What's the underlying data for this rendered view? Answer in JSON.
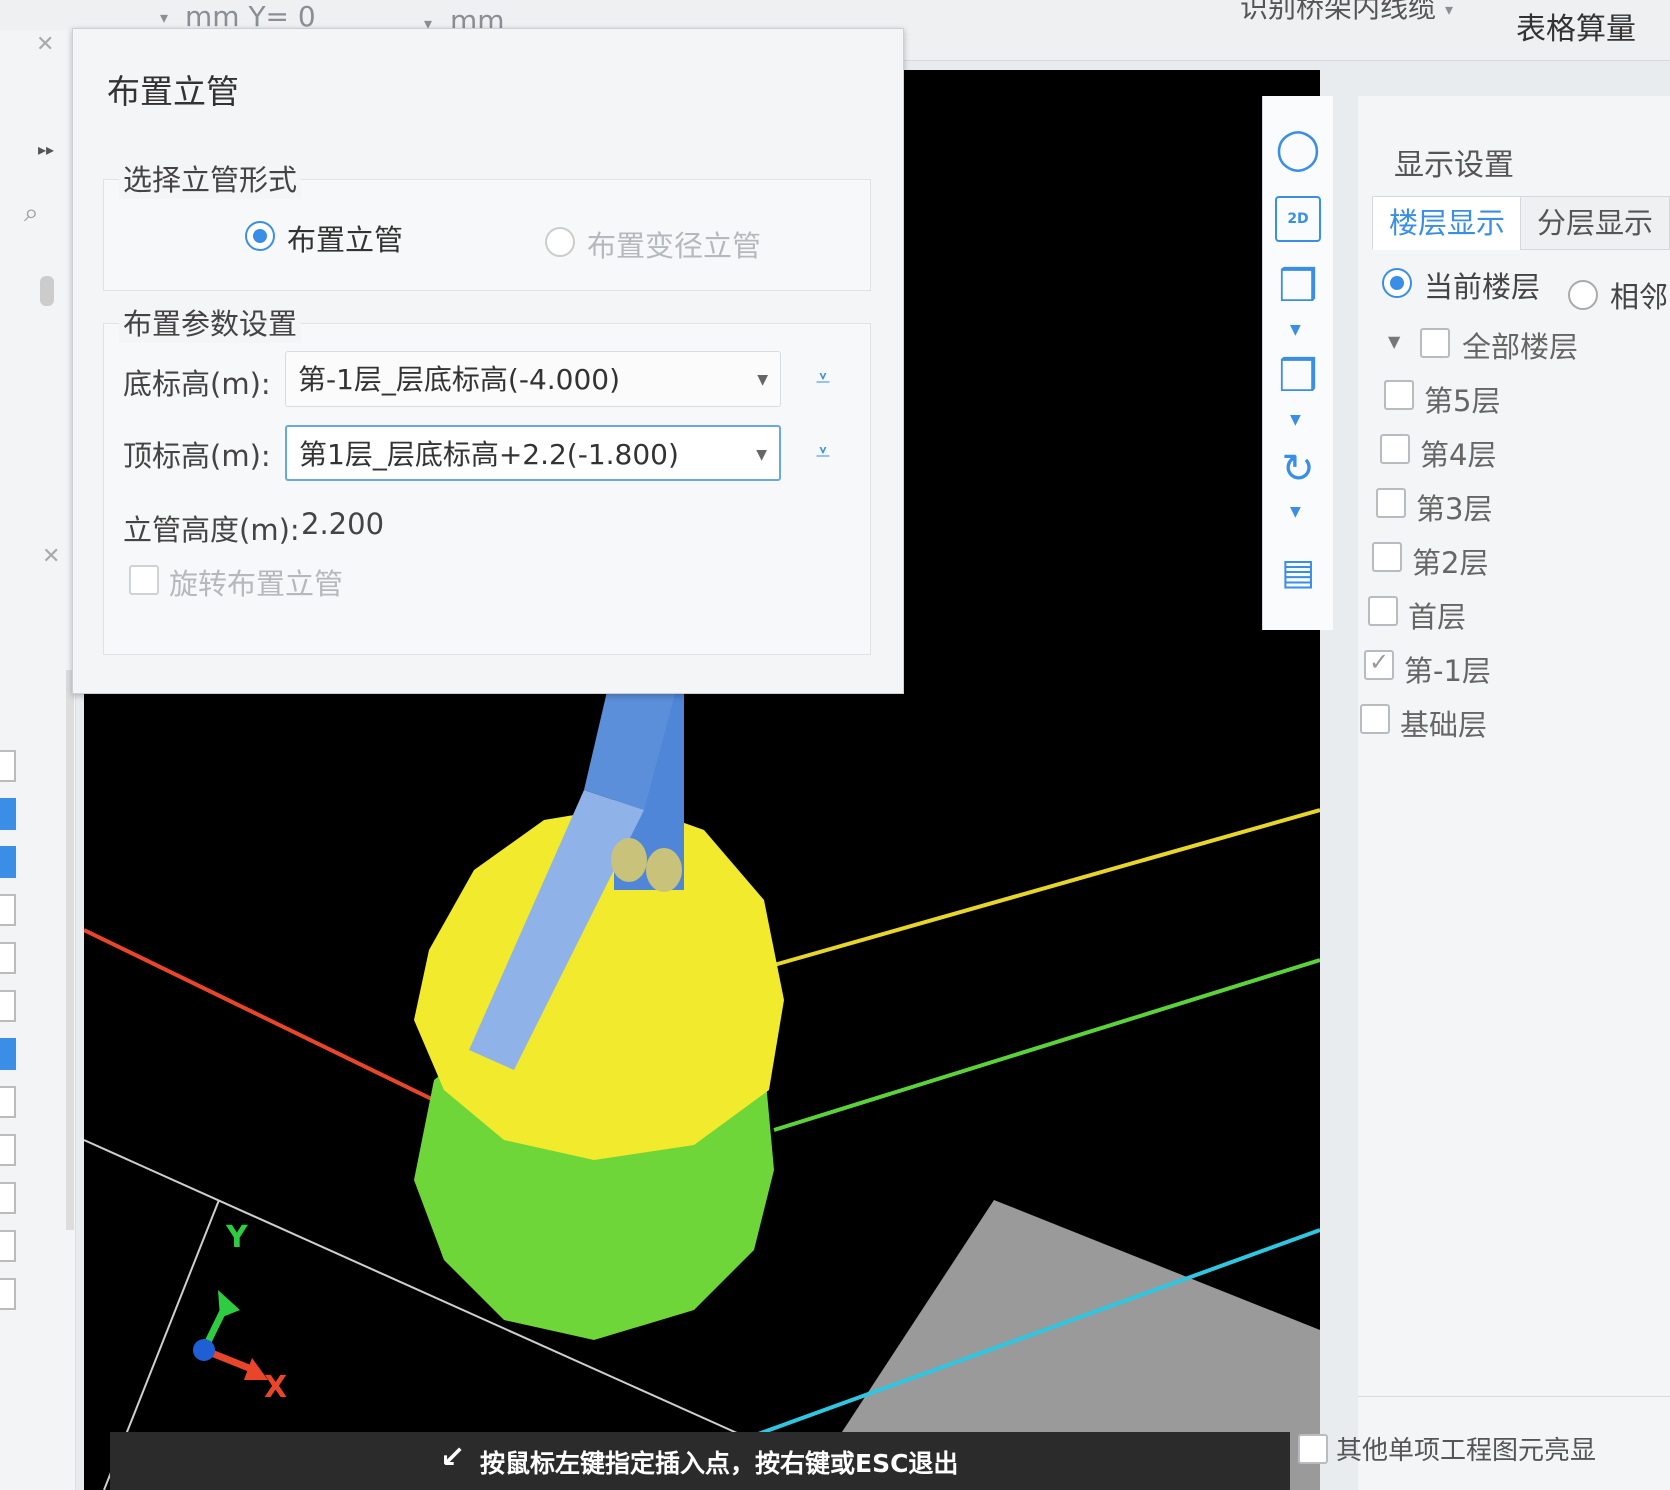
{
  "topbar": {
    "coord_prefix": "mm  Y= 0",
    "unit": "mm",
    "system_dropdown": "识别桥架内线缆",
    "table_calc": "表格算量"
  },
  "dialog": {
    "title": "布置立管",
    "form_group_title": "选择立管形式",
    "form_option_1": "布置立管",
    "form_option_2": "布置变径立管",
    "param_group_title": "布置参数设置",
    "bottom_label": "底标高(m):",
    "bottom_value": "第-1层_层底标高(-4.000)",
    "top_label": "顶标高(m):",
    "top_value": "第1层_层底标高+2.2(-1.800)",
    "height_label": "立管高度(m):",
    "height_value": "2.200",
    "rotate_label": "旋转布置立管"
  },
  "viewtools": {
    "items": [
      "orbit-icon",
      "2d-view-icon",
      "cube-view-icon",
      "cube-solid-icon",
      "rotate-icon",
      "display-settings-icon"
    ],
    "2d_label": "2D"
  },
  "right_panel": {
    "title": "显示设置",
    "tab_floor": "楼层显示",
    "tab_layer": "分层显示",
    "radio_current": "当前楼层",
    "radio_adjacent": "相邻",
    "tree_root": "全部楼层",
    "floors": [
      {
        "label": "第5层",
        "checked": false
      },
      {
        "label": "第4层",
        "checked": false
      },
      {
        "label": "第3层",
        "checked": false
      },
      {
        "label": "第2层",
        "checked": false
      },
      {
        "label": "首层",
        "checked": false
      },
      {
        "label": "第-1层",
        "checked": true
      },
      {
        "label": "基础层",
        "checked": false
      }
    ],
    "bottom_option": "其他单项工程图元亮显"
  },
  "statusbar": {
    "hint": "按鼠标左键指定插入点，按右键或ESC退出"
  },
  "axes": {
    "y_label": "Y",
    "x_label": "X"
  },
  "colors": {
    "accent": "#3a8ee6",
    "viewport_bg": "#000000",
    "pipe_blue": "#5b8fd9",
    "yellow_sphere": "#f2ea2c",
    "green_sphere": "#6fd63a",
    "axis_red": "#e8452a",
    "axis_green": "#2ecc40",
    "axis_blue": "#1f5fd6"
  }
}
